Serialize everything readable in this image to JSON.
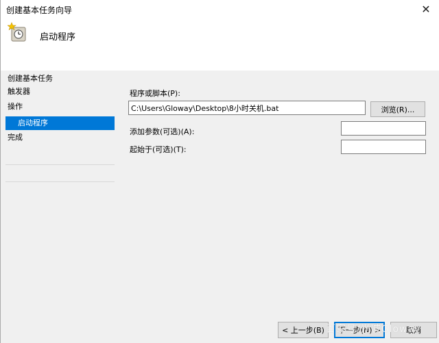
{
  "window": {
    "title": "创建基本任务向导",
    "close_glyph": "✕"
  },
  "header": {
    "heading": "启动程序",
    "icon": "task-wizard-icon"
  },
  "sidebar": {
    "group_title": "创建基本任务",
    "items": [
      {
        "label": "触发器"
      },
      {
        "label": "操作"
      },
      {
        "label": "启动程序",
        "selected": true
      },
      {
        "label": "完成"
      }
    ]
  },
  "form": {
    "program_label": "程序或脚本(P):",
    "program_value": "C:\\Users\\Gloway\\Desktop\\8小时关机.bat",
    "browse_label": "浏览(R)...",
    "args_label": "添加参数(可选)(A):",
    "args_value": "",
    "startin_label": "起始于(可选)(T):",
    "startin_value": ""
  },
  "footer": {
    "back_label": "< 上一步(B)",
    "next_label": "下一步(N) >",
    "cancel_label": "取消",
    "watermark": "百家号/光减Gloway"
  },
  "colors": {
    "accent": "#0078d7",
    "background": "#f0f0f0",
    "header_bg": "#ffffff"
  }
}
